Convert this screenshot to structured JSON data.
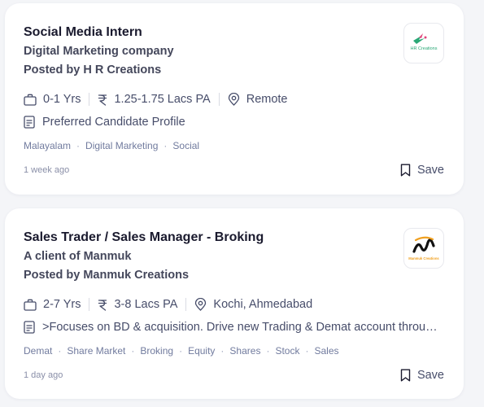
{
  "jobs": [
    {
      "title": "Social Media Intern",
      "company": "Digital Marketing company",
      "posted_by": "Posted by H R Creations",
      "logo_text": "HR Creations",
      "experience": "0-1 Yrs",
      "salary": "1.25-1.75 Lacs PA",
      "location": "Remote",
      "description": "Preferred Candidate Profile",
      "tags": [
        "Malayalam",
        "Digital Marketing",
        "Social"
      ],
      "posted_ago": "1 week ago",
      "save_label": "Save"
    },
    {
      "title": "Sales Trader / Sales Manager - Broking",
      "company": "A client of Manmuk",
      "posted_by": "Posted by Manmuk Creations",
      "logo_text": "Manmuk Creations",
      "experience": "2-7 Yrs",
      "salary": "3-8 Lacs PA",
      "location": "Kochi, Ahmedabad",
      "description": ">Focuses on BD & acquisition. Drive new Trading & Demat account through...",
      "tags": [
        "Demat",
        "Share Market",
        "Broking",
        "Equity",
        "Shares",
        "Stock",
        "Sales"
      ],
      "posted_ago": "1 day ago",
      "save_label": "Save"
    }
  ],
  "colors": {
    "page_bg": "#f4f5f8",
    "card_bg": "#ffffff",
    "title": "#1a1a2e",
    "text": "#474d6a",
    "tag": "#717b9e",
    "hr_logo_green": "#2aa876",
    "hr_logo_red": "#e0457b",
    "manmuk_logo_orange": "#f0a020"
  },
  "icons": {
    "experience": "briefcase-icon",
    "salary": "rupee-icon",
    "location": "location-pin-icon",
    "description": "document-icon",
    "save": "bookmark-icon"
  }
}
